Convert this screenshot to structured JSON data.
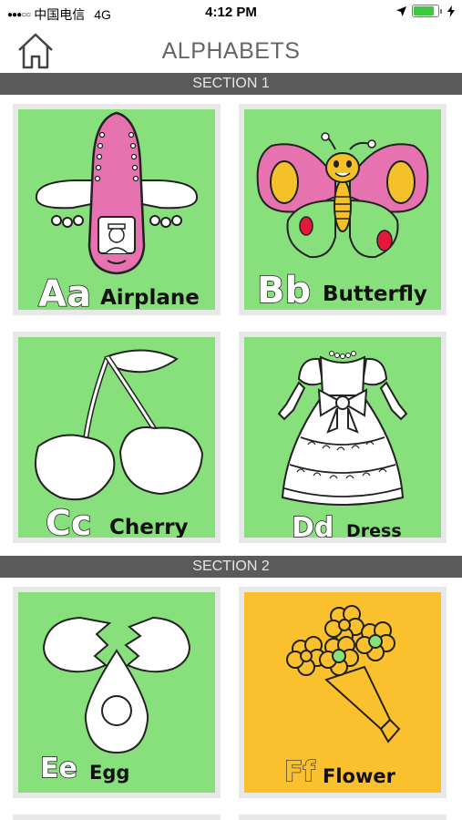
{
  "status_bar": {
    "carrier": "中国电信",
    "network": "4G",
    "time": "4:12 PM"
  },
  "header": {
    "title": "ALPHABETS"
  },
  "sections": [
    {
      "label": "SECTION 1"
    },
    {
      "label": "SECTION 2"
    }
  ],
  "cards": [
    {
      "letters": "Aa",
      "word": "Airplane",
      "bg": "#88e07c"
    },
    {
      "letters": "Bb",
      "word": "Butterfly",
      "bg": "#88e07c"
    },
    {
      "letters": "Cc",
      "word": "Cherry",
      "bg": "#88e07c"
    },
    {
      "letters": "Dd",
      "word": "Dress",
      "bg": "#88e07c"
    },
    {
      "letters": "Ee",
      "word": "Egg",
      "bg": "#88e07c"
    },
    {
      "letters": "Ff",
      "word": "Flower",
      "bg": "#fbc02d"
    }
  ],
  "colors": {
    "section_bar": "#5a5a5a",
    "card_green": "#88e07c",
    "card_yellow": "#fbc02d",
    "airplane_pink": "#e673b0",
    "butterfly_yellow": "#f5c12b",
    "butterfly_red": "#e5173d"
  }
}
